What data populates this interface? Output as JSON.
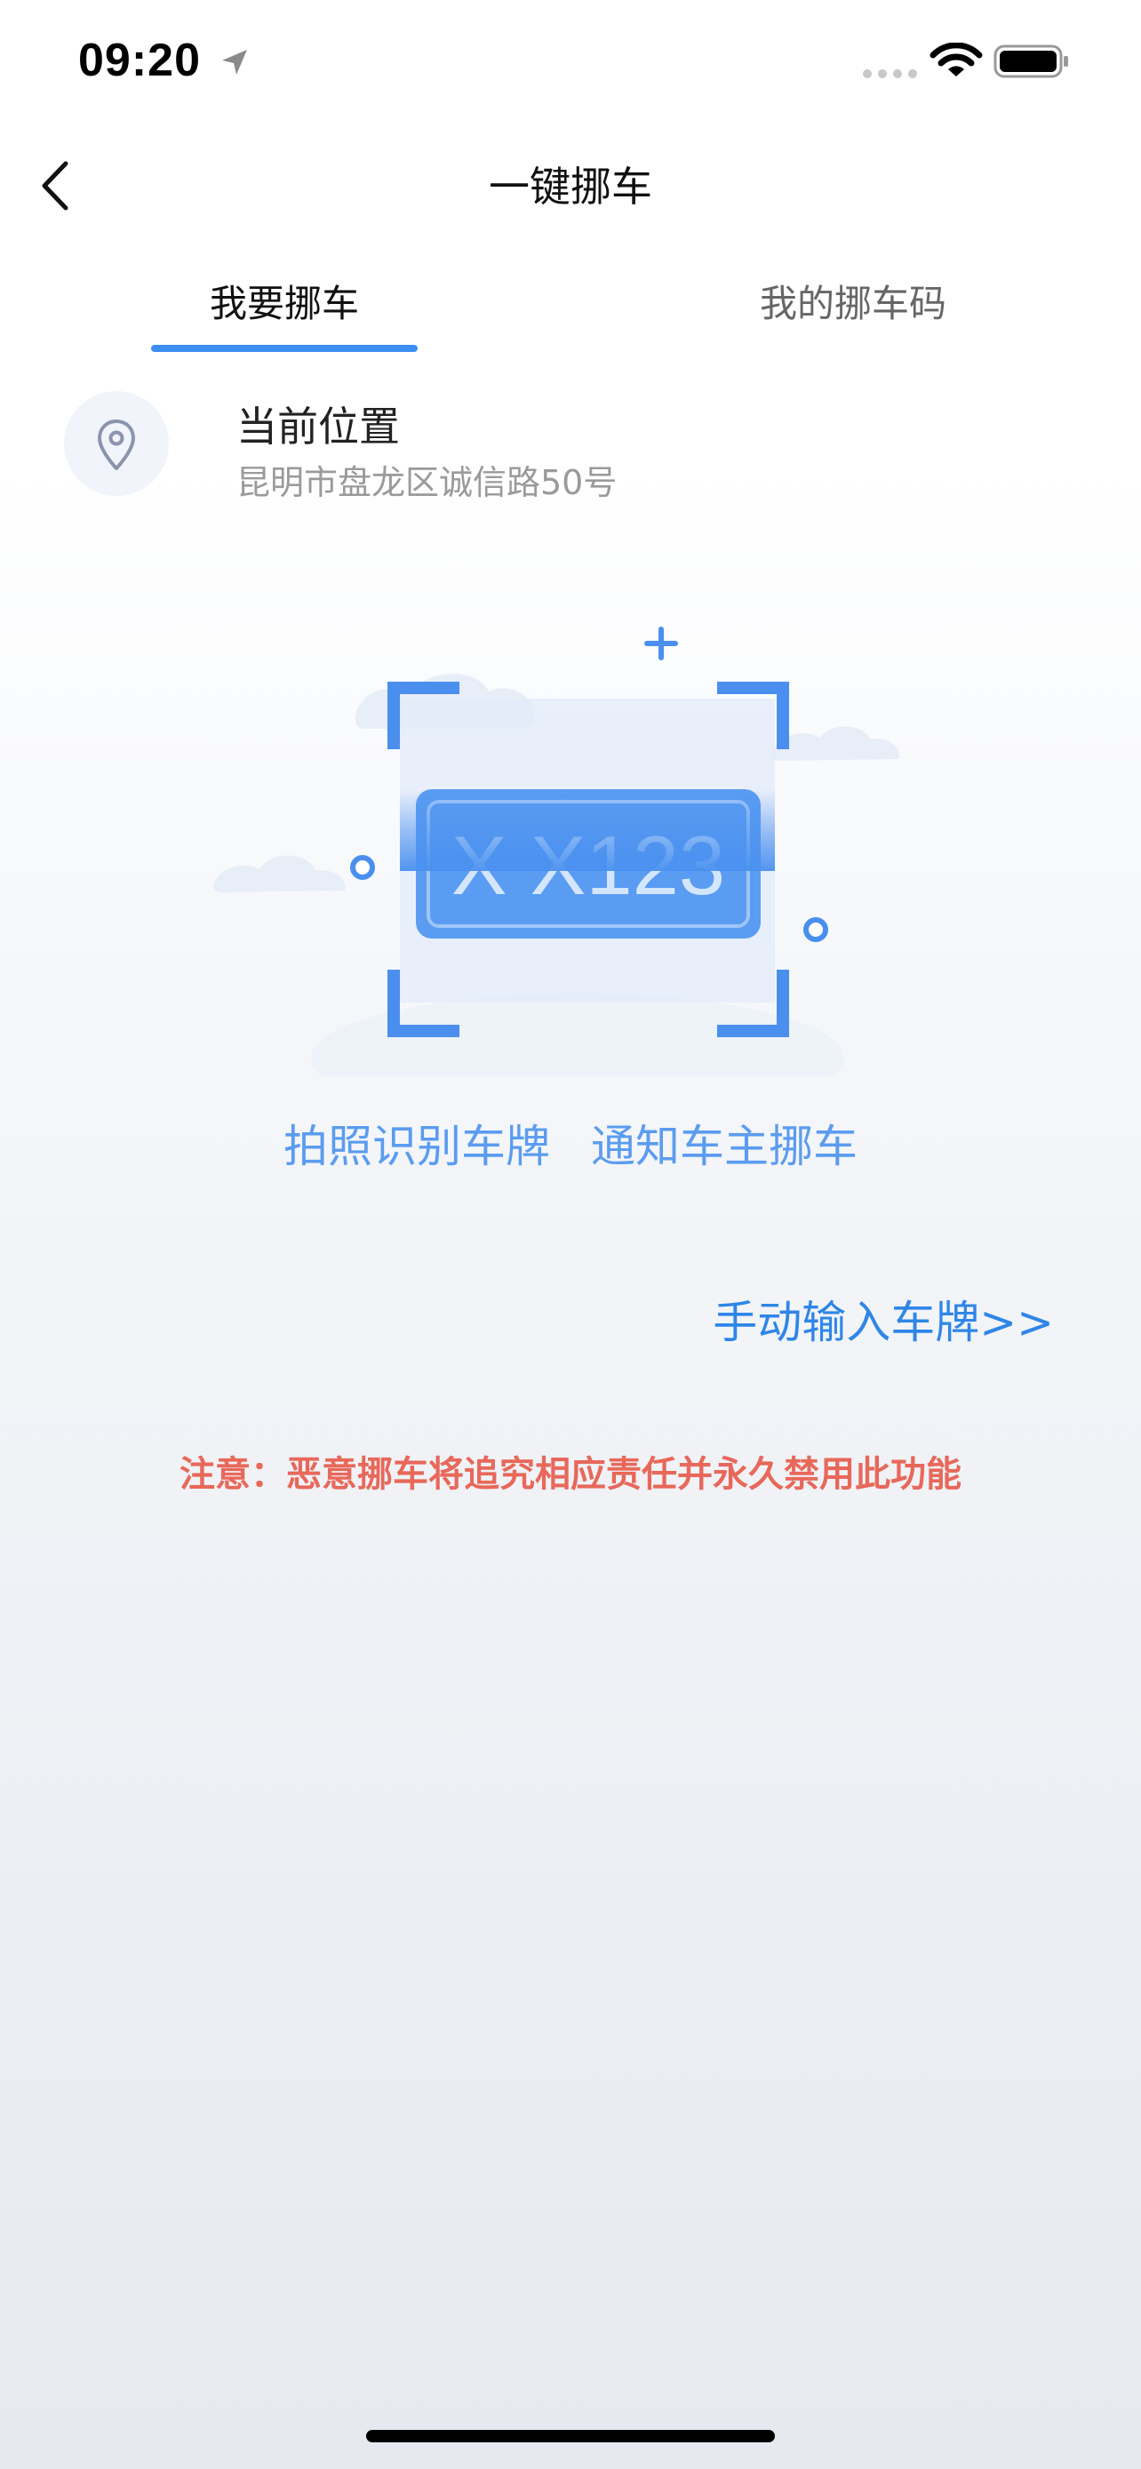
{
  "status_bar": {
    "time": "09:20",
    "icons": [
      "location-arrow-icon",
      "signal-dots-icon",
      "wifi-icon",
      "battery-icon"
    ]
  },
  "nav": {
    "title": "一键挪车",
    "back_icon": "chevron-left-icon"
  },
  "tabs": [
    {
      "label": "我要挪车",
      "active": true
    },
    {
      "label": "我的挪车码",
      "active": false
    }
  ],
  "location": {
    "icon": "map-pin-icon",
    "title": "当前位置",
    "address": "昆明市盘龙区诚信路50号"
  },
  "illustration": {
    "plate_text": "X X123"
  },
  "steps": {
    "step1": "拍照识别车牌",
    "step2": "通知车主挪车"
  },
  "manual_input": "手动输入车牌>>",
  "notice": "注意：恶意挪车将追究相应责任并永久禁用此功能",
  "colors": {
    "accent": "#3d8ef2",
    "link": "#2f86e8",
    "steps": "#5b9cf0",
    "warning": "#e8685a"
  }
}
